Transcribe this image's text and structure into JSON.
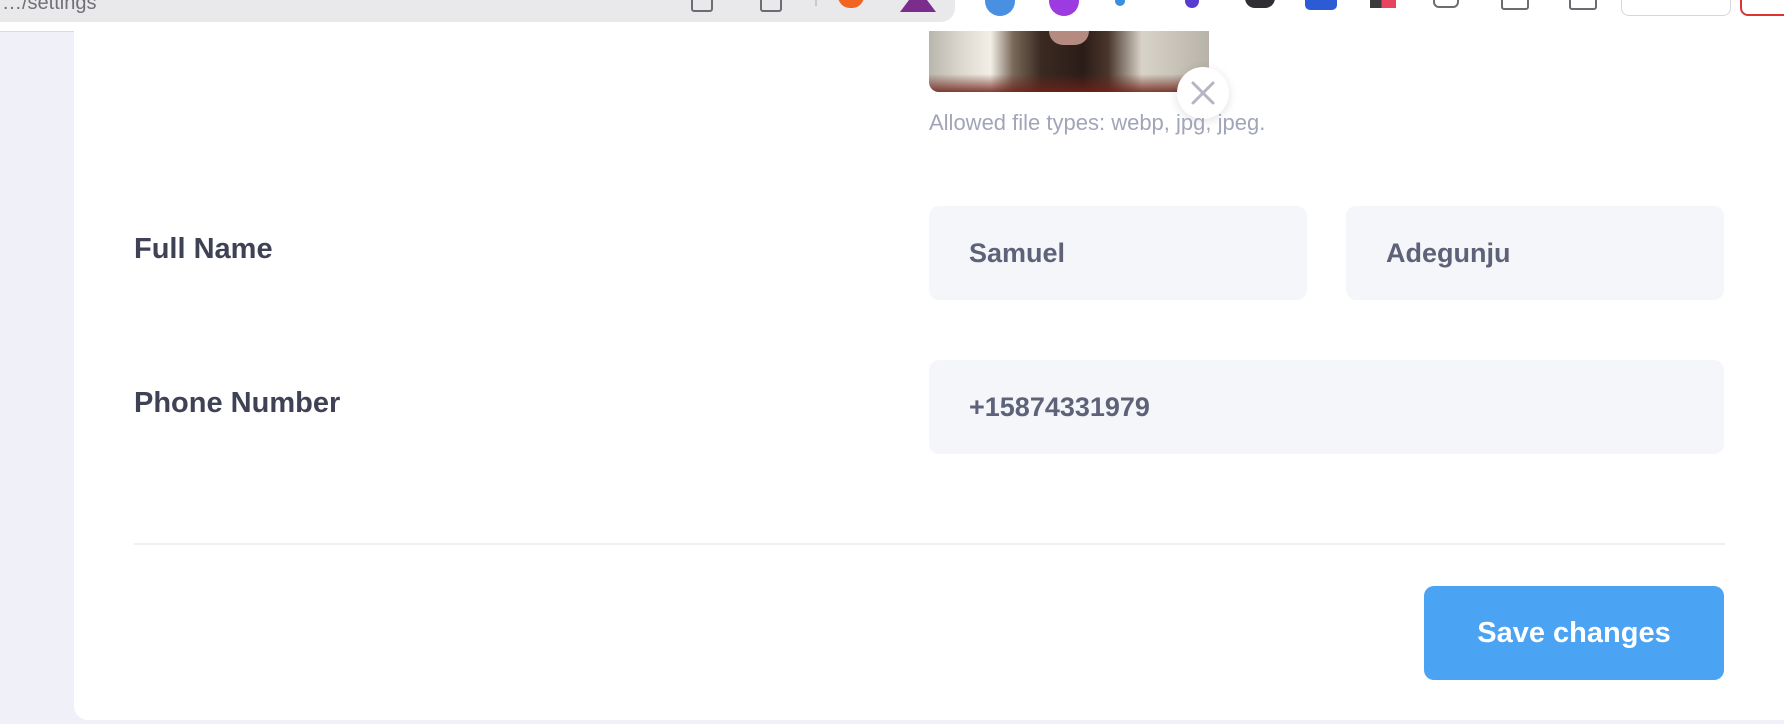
{
  "browser": {
    "url_fragment": "…/settings"
  },
  "profile": {
    "avatar_hint": "Allowed file types: webp, jpg, jpeg.",
    "full_name_label": "Full Name",
    "first_name_value": "Samuel",
    "last_name_value": "Adegunju",
    "phone_label": "Phone Number",
    "phone_value": "+15874331979"
  },
  "actions": {
    "save_label": "Save changes"
  },
  "colors": {
    "primary": "#4aa3f3",
    "input_bg": "#f5f6f9",
    "label": "#3f4254",
    "hint": "#a1a5b7",
    "page_bg": "#eff0f8"
  }
}
